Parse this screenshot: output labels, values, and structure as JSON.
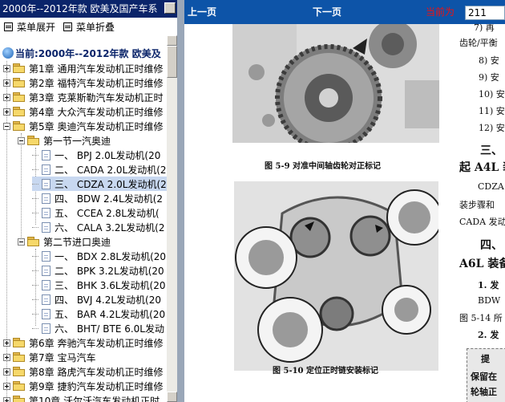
{
  "window": {
    "title": "2000年--2012年款 欧美及国产车系"
  },
  "menu": {
    "expand_label": "菜单展开",
    "collapse_label": "菜单折叠"
  },
  "tree": {
    "current_label": "当前:2000年--2012年款 欧美及",
    "items": [
      {
        "label": "第1章 通用汽车发动机正时维修"
      },
      {
        "label": "第2章 福特汽车发动机正时维修"
      },
      {
        "label": "第3章 克莱斯勒汽车发动机正时"
      },
      {
        "label": "第4章 大众汽车发动机正时维修"
      },
      {
        "label": "第5章 奥迪汽车发动机正时维修"
      },
      {
        "label": "第一节一汽奥迪"
      },
      {
        "label": "一、 BPJ 2.0L发动机(20"
      },
      {
        "label": "二、 CADA 2.0L发动机(2"
      },
      {
        "label": "三、 CDZA 2.0L发动机(2"
      },
      {
        "label": "四、 BDW 2.4L发动机(2"
      },
      {
        "label": "五、 CCEA 2.8L发动机("
      },
      {
        "label": "六、 CALA 3.2L发动机(2"
      },
      {
        "label": "第二节进口奥迪"
      },
      {
        "label": "一、 BDX 2.8L发动机(20"
      },
      {
        "label": "二、 BPK 3.2L发动机(20"
      },
      {
        "label": "三、 BHK 3.6L发动机(20"
      },
      {
        "label": "四、 BVJ 4.2L发动机(20"
      },
      {
        "label": "五、 BAR 4.2L发动机(20"
      },
      {
        "label": "六、 BHT/ BTE 6.0L发动"
      },
      {
        "label": "第6章 奔驰汽车发动机正时维修"
      },
      {
        "label": "第7章 宝马汽车"
      },
      {
        "label": "第8章 路虎汽车发动机正时维修"
      },
      {
        "label": "第9章 捷豹汽车发动机正时维修"
      },
      {
        "label": "第10章 沃尔沃汽车发动机正时"
      }
    ]
  },
  "toolbar": {
    "prev_label": "上一页",
    "next_label": "下一页",
    "current_page_label": "当前为",
    "current_page_value": "211"
  },
  "page": {
    "fig9_caption": "图 5-9   对准中间轴齿轮对正标记",
    "fig10_caption": "图 5-10   定位正时链安装标记",
    "right_col": [
      "7) 再",
      "齿轮/平衡",
      "8) 安",
      "9) 安",
      "10) 安",
      "11) 安",
      "12) 安",
      "三、",
      "起 A4L 装",
      "CDZA",
      "装步骤和",
      "CADA 发动",
      "四、",
      "A6L 装备",
      "1. 发",
      "BDW",
      "图 5-14 所",
      "2. 发",
      "提",
      "保留在",
      "轮轴正"
    ]
  }
}
